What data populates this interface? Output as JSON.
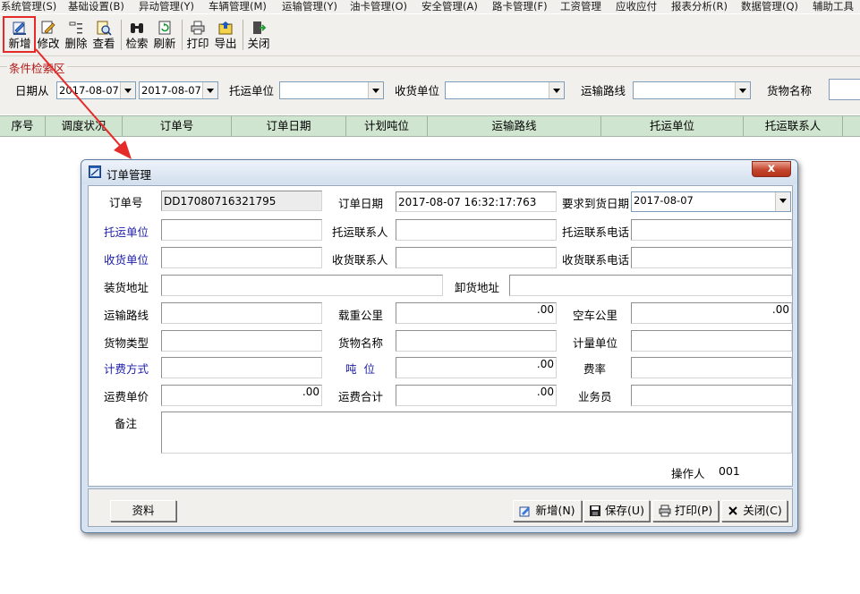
{
  "menu": [
    "系统管理(S)",
    "基础设置(B)",
    "异动管理(Y)",
    "车辆管理(M)",
    "运输管理(Y)",
    "油卡管理(O)",
    "安全管理(A)",
    "路卡管理(F)",
    "工资管理",
    "应收应付",
    "报表分析(R)",
    "数据管理(Q)",
    "辅助工具"
  ],
  "toolbar": {
    "new": "新增",
    "edit": "修改",
    "delete": "删除",
    "view": "查看",
    "search": "检索",
    "refresh": "刷新",
    "print": "打印",
    "export": "导出",
    "close": "关闭"
  },
  "search_panel": {
    "legend": "条件检索区",
    "date_from_label": "日期从",
    "date_from": "2017-08-07",
    "date_to": "2017-08-07",
    "consignor_label": "托运单位",
    "consignor": "",
    "consignee_label": "收货单位",
    "consignee": "",
    "route_label": "运输路线",
    "route": "",
    "goods_label": "货物名称",
    "goods": ""
  },
  "grid": {
    "columns": [
      "序号",
      "调度状况",
      "订单号",
      "订单日期",
      "计划吨位",
      "运输路线",
      "托运单位",
      "托运联系人"
    ]
  },
  "dialog": {
    "title": "订单管理",
    "close_glyph": "x",
    "labels": {
      "order_no": "订单号",
      "order_date": "订单日期",
      "required_date": "要求到货日期",
      "consignor": "托运单位",
      "consignor_contact": "托运联系人",
      "consignor_phone": "托运联系电话",
      "consignee": "收货单位",
      "consignee_contact": "收货联系人",
      "consignee_phone": "收货联系电话",
      "load_addr": "装货地址",
      "unload_addr": "卸货地址",
      "route": "运输路线",
      "loaded_km": "载重公里",
      "empty_km": "空车公里",
      "goods_type": "货物类型",
      "goods_name": "货物名称",
      "unit": "计量单位",
      "billing": "计费方式",
      "tonnage": "吨  位",
      "rate": "费率",
      "freight_price": "运费单价",
      "freight_total": "运费合计",
      "salesman": "业务员",
      "remark": "备注",
      "operator": "操作人"
    },
    "values": {
      "order_no": "DD17080716321795",
      "order_date": "2017-08-07 16:32:17:763",
      "required_date": "2017-08-07",
      "consignor": "",
      "consignor_contact": "",
      "consignor_phone": "",
      "consignee": "",
      "consignee_contact": "",
      "consignee_phone": "",
      "load_addr": "",
      "unload_addr": "",
      "route": "",
      "loaded_km": ".00",
      "empty_km": ".00",
      "goods_type": "",
      "goods_name": "",
      "unit": "",
      "billing": "",
      "tonnage": ".00",
      "rate": "",
      "freight_price": ".00",
      "freight_total": ".00",
      "salesman": "",
      "remark": "",
      "operator": "001"
    },
    "buttons": {
      "data": "资料",
      "new": "新增(N)",
      "save": "保存(U)",
      "print": "打印(P)",
      "close": "关闭(C)"
    }
  },
  "colors": {
    "highlight": "#e52a2a",
    "grid_header": "#cfe5cf",
    "blue_label": "#1c1ca8",
    "legend": "#b01818"
  }
}
